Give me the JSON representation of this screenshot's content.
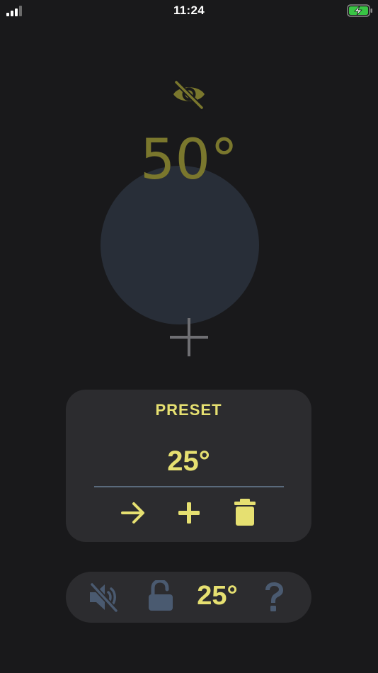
{
  "status_bar": {
    "time": "11:24",
    "signal_icon": "cellular-signal-icon",
    "battery_icon": "battery-charging-icon",
    "battery_color": "#39c545"
  },
  "display": {
    "visibility_icon": "eye-slash-icon",
    "temperature": "50°",
    "temperature_color": "#7a772d",
    "dial_color": "#282e38",
    "crosshair_icon": "crosshair-icon"
  },
  "preset": {
    "title": "PRESET",
    "value": "25°",
    "accent_color": "#e6e071",
    "actions": [
      "arrow-right-icon",
      "plus-icon",
      "trash-icon"
    ]
  },
  "bottom_bar": {
    "mute_icon": "speaker-mute-icon",
    "lock_icon": "unlock-icon",
    "temperature": "25°",
    "help_icon": "question-icon",
    "inactive_icon_color": "#4a5a70"
  }
}
